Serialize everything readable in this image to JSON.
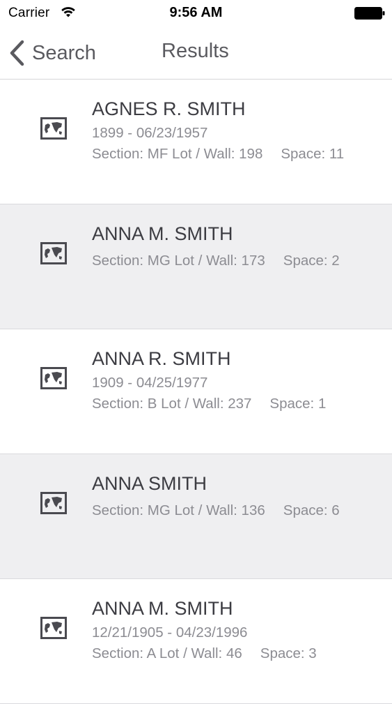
{
  "status_bar": {
    "carrier": "Carrier",
    "time": "9:56 AM",
    "wifi_icon": "wifi-icon",
    "battery_icon": "battery-icon"
  },
  "nav": {
    "back_label": "Search",
    "back_icon": "chevron-left-icon",
    "title": "Results"
  },
  "colors": {
    "text_primary": "#3c3c42",
    "text_secondary": "#8c8c92",
    "row_shaded": "#efeff1",
    "separator": "#dadadd"
  },
  "results": [
    {
      "name": "AGNES R. SMITH",
      "dates": "1899 - 06/23/1957",
      "section": "Section: MF Lot / Wall: 198",
      "space": "Space: 11",
      "icon": "map-icon"
    },
    {
      "name": "ANNA M. SMITH",
      "dates": "",
      "section": "Section: MG Lot / Wall: 173",
      "space": "Space: 2",
      "icon": "map-icon"
    },
    {
      "name": "ANNA R. SMITH",
      "dates": "1909 - 04/25/1977",
      "section": "Section: B Lot / Wall: 237",
      "space": "Space: 1",
      "icon": "map-icon"
    },
    {
      "name": "ANNA SMITH",
      "dates": "",
      "section": "Section: MG Lot / Wall: 136",
      "space": "Space: 6",
      "icon": "map-icon"
    },
    {
      "name": "ANNA M. SMITH",
      "dates": "12/21/1905 - 04/23/1996",
      "section": "Section: A Lot / Wall: 46",
      "space": "Space: 3",
      "icon": "map-icon"
    }
  ]
}
